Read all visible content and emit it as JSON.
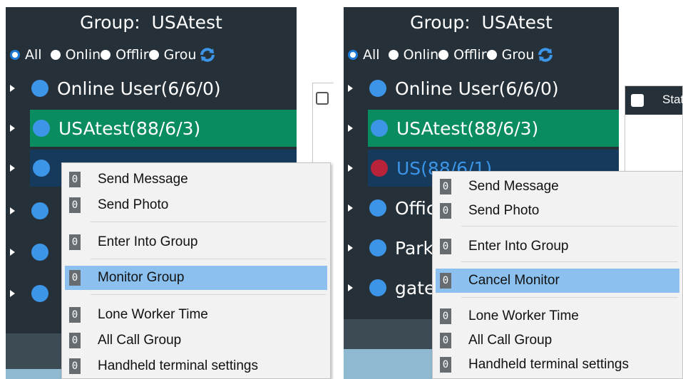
{
  "colors": {
    "tree_bg": "#253038",
    "selected_green": "#0a8c61",
    "selected_dark": "#163a5c",
    "dot_blue": "#3d95e8",
    "dot_red": "#b8233a",
    "menu_bg": "#f2f2f2",
    "menu_highlight": "#8cc1ef"
  },
  "left": {
    "group_title": "Group:  USAtest",
    "filters": [
      "All",
      "Onlin",
      "Offlir",
      "Grou"
    ],
    "rows": [
      {
        "label": "Online User(6/6/0)"
      },
      {
        "label": "USAtest(88/6/3)"
      }
    ],
    "menu_icon": "0",
    "menu": [
      "Send Message",
      "Send Photo",
      "Enter Into Group",
      "Monitor Group",
      "Lone Worker Time",
      "All Call Group",
      "Handheld terminal settings"
    ]
  },
  "right": {
    "group_title": "Group:  USAtest",
    "filters": [
      "All",
      "Onlin",
      "Offlir",
      "Grou"
    ],
    "rows": [
      {
        "label": "Online User(6/6/0)"
      },
      {
        "label": "USAtest(88/6/3)"
      },
      {
        "label": "US(88/6/1)"
      },
      {
        "label": "Offic"
      },
      {
        "label": "Parki"
      },
      {
        "label": "gatev"
      }
    ],
    "side_header": "Stat",
    "menu_icon": "0",
    "menu": [
      "Send Message",
      "Send Photo",
      "Enter Into Group",
      "Cancel Monitor",
      "Lone Worker Time",
      "All Call Group",
      "Handheld terminal settings"
    ]
  }
}
